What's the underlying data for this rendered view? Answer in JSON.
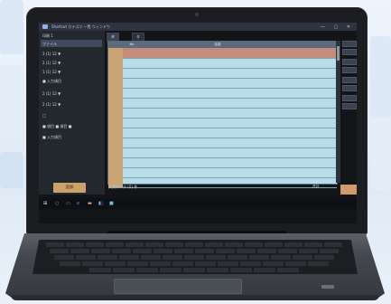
{
  "window": {
    "title": "Shortcut カテゴリ 一覧 ウィンドウ",
    "controls": "— ▢ ✕"
  },
  "left_panel": {
    "rows": [
      "印刷 1",
      "ファイル",
      "3 (1) 12 ▼",
      "2 (1) 12 ▼",
      "1 (1) 12 ▼",
      "■ 入力項目",
      "2 (1) 12 ▼",
      "2 (1) 12 ▼",
      "□",
      "■ 項目 ■ 項目 ■",
      "■ 入力項目"
    ],
    "action_button": "追加"
  },
  "tabs": [
    {
      "label": "タブ 1",
      "active": true
    },
    {
      "label": "タブ 2",
      "active": false
    }
  ],
  "grid": {
    "columns": [
      "",
      "No",
      "名前",
      "",
      ""
    ],
    "rows": [
      {
        "num": "",
        "id": "",
        "name": "",
        "c4": "",
        "c5": "",
        "selected": true
      },
      {
        "num": "",
        "id": "",
        "name": "",
        "c4": "",
        "c5": "",
        "selected": false
      },
      {
        "num": "",
        "id": "",
        "name": "",
        "c4": "",
        "c5": "",
        "selected": false
      },
      {
        "num": "",
        "id": "",
        "name": "",
        "c4": "",
        "c5": "",
        "selected": false
      },
      {
        "num": "",
        "id": "",
        "name": "",
        "c4": "",
        "c5": "",
        "selected": false
      },
      {
        "num": "",
        "id": "",
        "name": "",
        "c4": "",
        "c5": "",
        "selected": false
      },
      {
        "num": "",
        "id": "",
        "name": "",
        "c4": "",
        "c5": "",
        "selected": false
      },
      {
        "num": "",
        "id": "",
        "name": "",
        "c4": "",
        "c5": "",
        "selected": false
      },
      {
        "num": "",
        "id": "",
        "name": "",
        "c4": "",
        "c5": "",
        "selected": false
      },
      {
        "num": "",
        "id": "",
        "name": "",
        "c4": "",
        "c5": "",
        "selected": false
      },
      {
        "num": "",
        "id": "",
        "name": "",
        "c4": "",
        "c5": "",
        "selected": false
      },
      {
        "num": "",
        "id": "",
        "name": "",
        "c4": "",
        "c5": "",
        "selected": false
      },
      {
        "num": "",
        "id": "",
        "name": "",
        "c4": "",
        "c5": "",
        "selected": false
      },
      {
        "num": "",
        "id": "",
        "name": "",
        "c4": "",
        "c5": "",
        "selected": false
      }
    ]
  },
  "right_panel": {
    "buttons": [
      "",
      "",
      "",
      "",
      "",
      "",
      "",
      ""
    ]
  },
  "footer": {
    "status": "入力データ (0) 件",
    "count_label": "合計",
    "count_value": "",
    "save_button": ""
  },
  "taskbar": {
    "icons": [
      "windows-logo-icon",
      "search-icon",
      "task-view-icon",
      "edge-icon",
      "explorer-icon",
      "store-icon",
      "app-icon"
    ],
    "time": "",
    "date": ""
  },
  "colors": {
    "grid_bg": "#b8dde8",
    "selected_row": "#c48c7a",
    "number_column": "#c8a572",
    "panel_bg": "#23272e",
    "accent_button": "#c9a36a"
  }
}
